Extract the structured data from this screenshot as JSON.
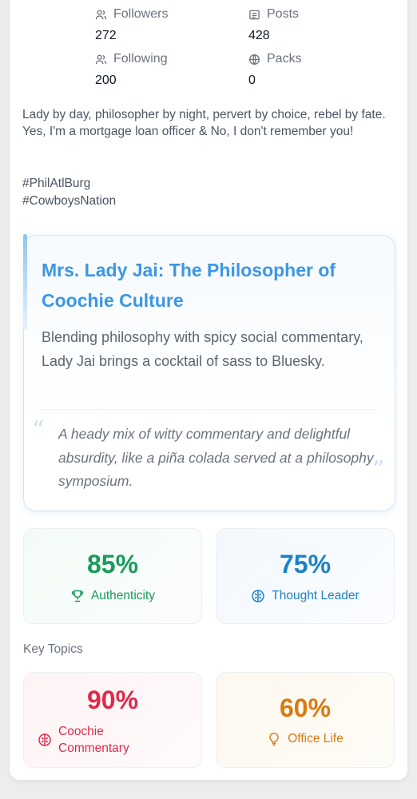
{
  "profile": {
    "stats": [
      {
        "label": "Followers",
        "value": "272",
        "icon": "users-icon"
      },
      {
        "label": "Posts",
        "value": "428",
        "icon": "posts-icon"
      },
      {
        "label": "Following",
        "value": "200",
        "icon": "user-icon"
      },
      {
        "label": "Packs",
        "value": "0",
        "icon": "globe-icon"
      }
    ],
    "bio": "Lady by day, philosopher by night, pervert by choice, rebel by fate. Yes, I'm a mortgage loan officer & No, I don't remember you!",
    "hashtags": [
      "#PhilAtlBurg",
      "#CowboysNation"
    ]
  },
  "feature": {
    "title": "Mrs. Lady Jai: The Philosopher of Coochie Culture",
    "description": "Blending philosophy with spicy social commentary, Lady Jai brings a cocktail of sass to Bluesky.",
    "quote": "A heady mix of witty commentary and delightful absurdity, like a piña colada served at a philosophy symposium."
  },
  "metrics": [
    {
      "value": "85%",
      "label": "Authenticity",
      "color": "#1a9c5b",
      "icon": "trophy-icon"
    },
    {
      "value": "75%",
      "label": "Thought Leader",
      "color": "#1c82c4",
      "icon": "brain-icon"
    }
  ],
  "key_topics": {
    "heading": "Key Topics",
    "items": [
      {
        "value": "90%",
        "label": "Coochie Commentary",
        "color": "#de2a4c",
        "icon": "brain-icon"
      },
      {
        "value": "60%",
        "label": "Office Life",
        "color": "#d97a0e",
        "icon": "lightbulb-icon"
      }
    ]
  }
}
